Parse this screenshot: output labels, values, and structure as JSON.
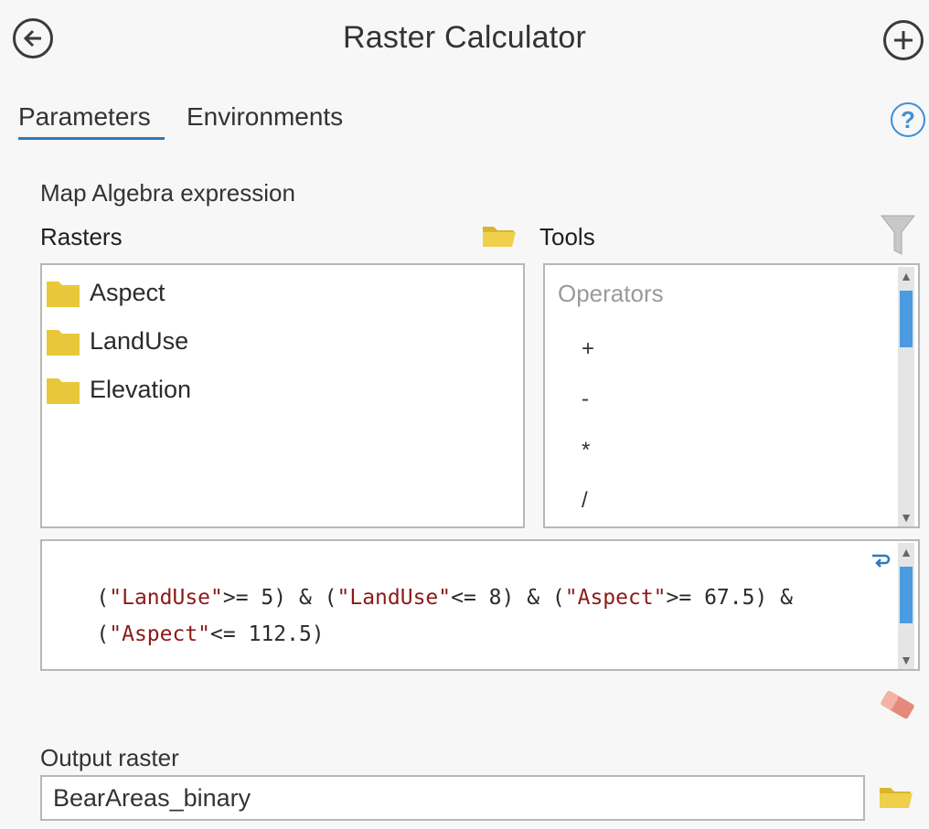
{
  "header": {
    "title": "Raster Calculator",
    "back_icon": "back-arrow-icon",
    "add_icon": "plus-icon"
  },
  "tabs": [
    {
      "label": "Parameters",
      "active": true
    },
    {
      "label": "Environments",
      "active": false
    }
  ],
  "help_symbol": "?",
  "map_algebra_label": "Map Algebra expression",
  "rasters": {
    "label": "Rasters",
    "items": [
      "Aspect",
      "LandUse",
      "Elevation"
    ]
  },
  "tools": {
    "label": "Tools",
    "group": "Operators",
    "operators": [
      "+",
      "-",
      "*",
      "/"
    ]
  },
  "expression": {
    "line1": [
      {
        "t": "(",
        "s": false
      },
      {
        "t": "\"LandUse\"",
        "s": true
      },
      {
        "t": ">= 5) & (",
        "s": false
      },
      {
        "t": "\"LandUse\"",
        "s": true
      },
      {
        "t": "<= 8) & (",
        "s": false
      },
      {
        "t": "\"Aspect\"",
        "s": true
      },
      {
        "t": ">= 67.5) &",
        "s": false
      }
    ],
    "line2": [
      {
        "t": "(",
        "s": false
      },
      {
        "t": "\"Aspect\"",
        "s": true
      },
      {
        "t": "<= 112.5)",
        "s": false
      }
    ]
  },
  "output": {
    "label": "Output raster",
    "value": "BearAreas_binary"
  },
  "colors": {
    "accent": "#2a7bbd",
    "folder": "#e8c83a",
    "string": "#8b1a1a",
    "scroll_thumb": "#4a9be0"
  }
}
